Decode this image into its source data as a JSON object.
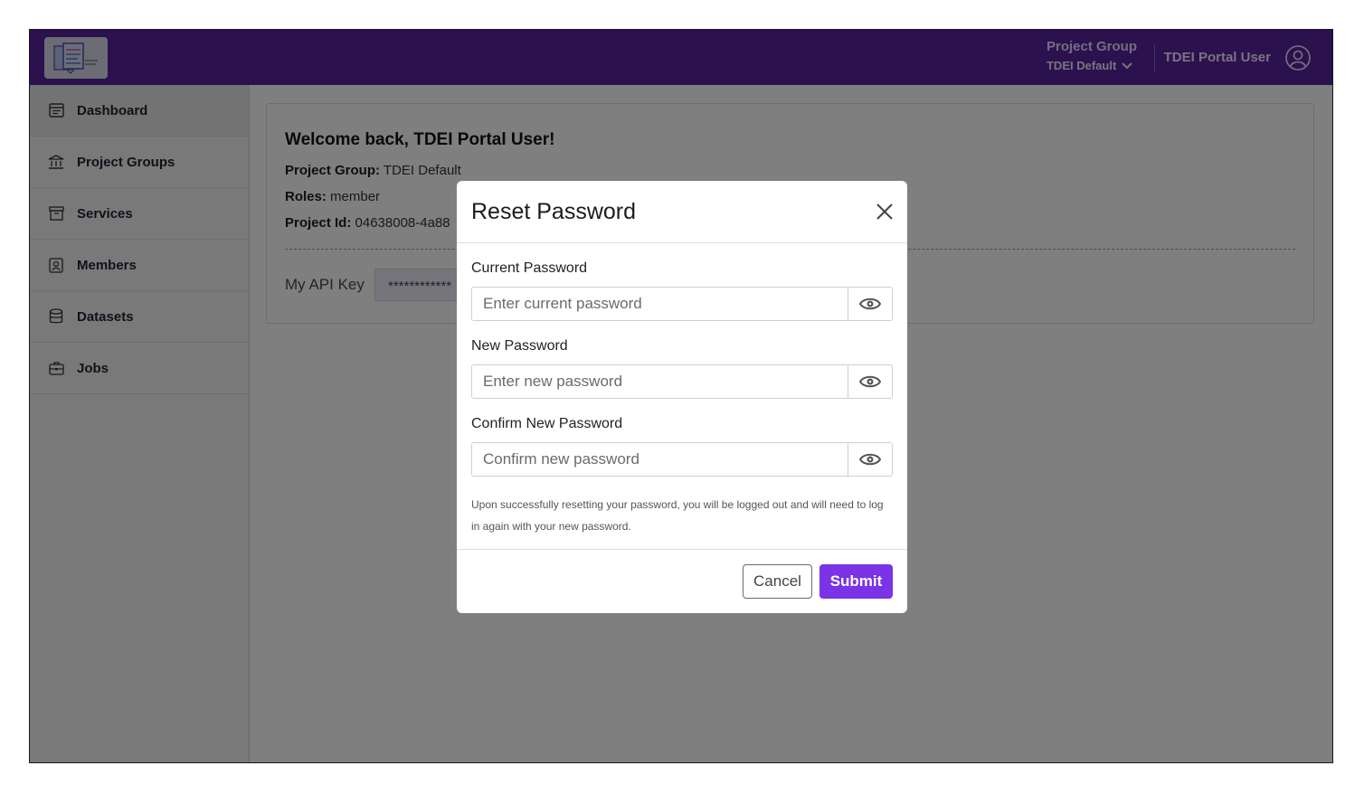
{
  "header": {
    "logo_icon": "tdei-logo",
    "project_group_title": "Project Group",
    "project_group_value": "TDEI Default",
    "user_name": "TDEI Portal User"
  },
  "sidebar": {
    "items": [
      {
        "label": "Dashboard",
        "icon": "dashboard-icon",
        "active": true
      },
      {
        "label": "Project Groups",
        "icon": "bank-icon"
      },
      {
        "label": "Services",
        "icon": "archive-icon"
      },
      {
        "label": "Members",
        "icon": "members-icon"
      },
      {
        "label": "Datasets",
        "icon": "database-icon"
      },
      {
        "label": "Jobs",
        "icon": "briefcase-icon"
      }
    ]
  },
  "main": {
    "welcome": "Welcome back, TDEI Portal User!",
    "project_group_label": "Project Group:",
    "project_group_value": "TDEI Default",
    "roles_label": "Roles:",
    "roles_value": "member",
    "project_id_label": "Project Id:",
    "project_id_value": "04638008-4a88",
    "api_key_label": "My API Key",
    "api_key_value": "************"
  },
  "modal": {
    "title": "Reset Password",
    "fields": [
      {
        "label": "Current Password",
        "placeholder": "Enter current password"
      },
      {
        "label": "New Password",
        "placeholder": "Enter new password"
      },
      {
        "label": "Confirm New Password",
        "placeholder": "Confirm new password"
      }
    ],
    "note": "Upon successfully resetting your password, you will be logged out and will need to log in again with your new password.",
    "cancel_label": "Cancel",
    "submit_label": "Submit"
  },
  "colors": {
    "header_bg": "#59239e",
    "submit_bg": "#7a33e6"
  }
}
